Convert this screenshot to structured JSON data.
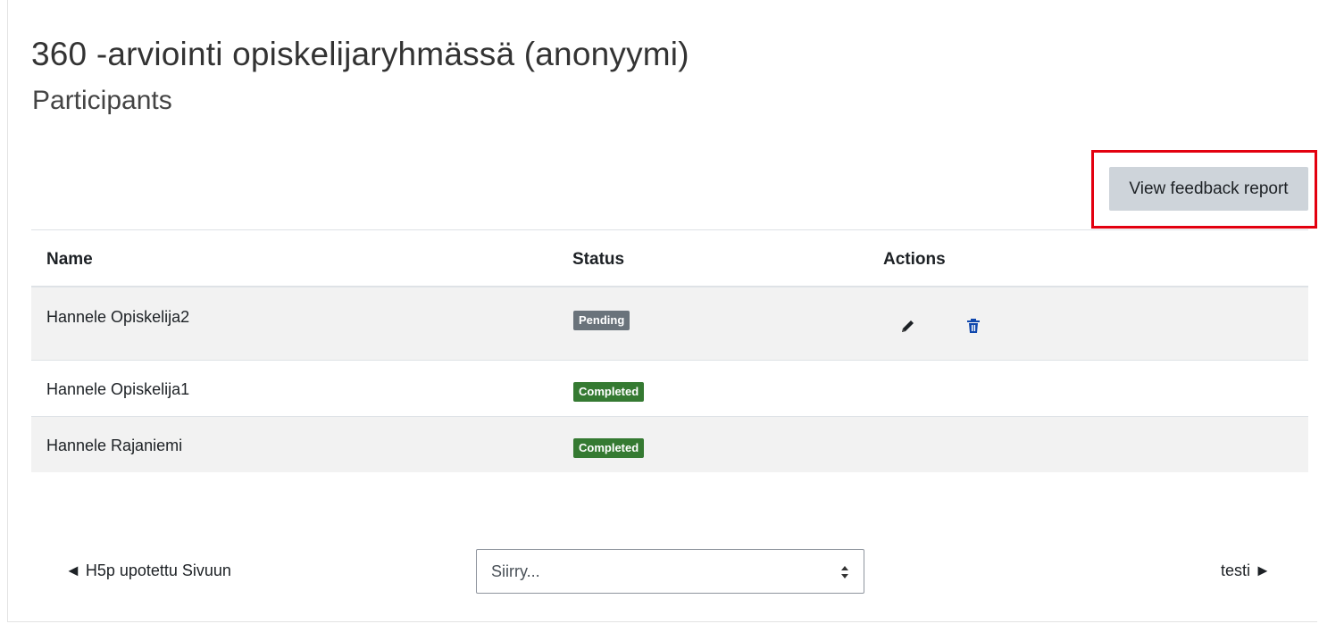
{
  "page": {
    "title": "360 -arviointi opiskelijaryhmässä (anonyymi)",
    "subtitle": "Participants"
  },
  "toolbar": {
    "report_label": "View feedback report"
  },
  "table": {
    "headers": {
      "name": "Name",
      "status": "Status",
      "actions": "Actions"
    },
    "rows": [
      {
        "name": "Hannele Opiskelija2",
        "status": "Pending",
        "status_color": "#6a737b",
        "actions": [
          "edit-icon",
          "delete-icon"
        ]
      },
      {
        "name": "Hannele Opiskelija1",
        "status": "Completed",
        "status_color": "#357a32",
        "actions": []
      },
      {
        "name": "Hannele Rajaniemi",
        "status": "Completed",
        "status_color": "#357a32",
        "actions": []
      }
    ]
  },
  "navigation": {
    "prev_label": "◄ H5p upotettu Sivuun",
    "jump_placeholder": "Siirry...",
    "next_label": "testi ►"
  },
  "colors": {
    "highlight": "#e3000f",
    "button_bg": "#ced4da"
  }
}
